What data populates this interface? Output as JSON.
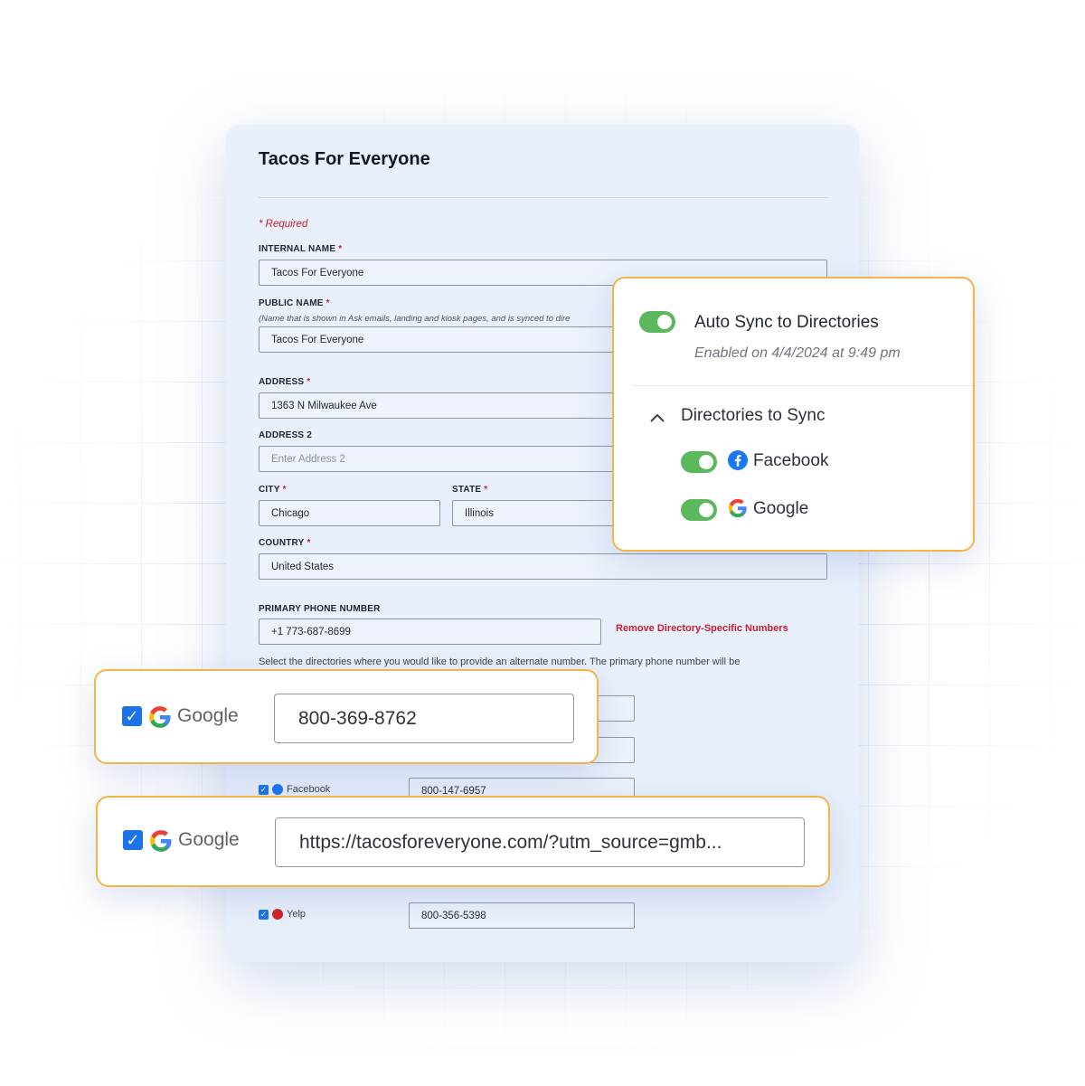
{
  "form": {
    "title": "Tacos For Everyone",
    "required_note": "* Required",
    "internal_name": {
      "label": "INTERNAL NAME",
      "value": "Tacos For Everyone"
    },
    "public_name": {
      "label": "PUBLIC NAME",
      "helper": "(Name that is shown in Ask emails, landing and kiosk pages, and is synced to dire",
      "value": "Tacos For Everyone"
    },
    "address": {
      "label": "ADDRESS",
      "value": "1363 N Milwaukee Ave"
    },
    "address2": {
      "label": "ADDRESS 2",
      "placeholder": "Enter Address 2"
    },
    "city": {
      "label": "CITY",
      "value": "Chicago"
    },
    "state": {
      "label": "STATE",
      "value": "Illinois"
    },
    "country": {
      "label": "COUNTRY",
      "value": "United States"
    },
    "primary_phone": {
      "label": "PRIMARY PHONE NUMBER",
      "value": "+1 773-687-8699"
    },
    "remove_link": "Remove Directory-Specific Numbers",
    "select_text": "Select the directories where you would like to provide an alternate number. The primary phone number will be",
    "directories": [
      {
        "name": "Facebook",
        "number": "800-147-6957"
      },
      {
        "name": "Yelp",
        "number": "800-356-5398"
      }
    ]
  },
  "sync_card": {
    "auto_sync_label": "Auto Sync to Directories",
    "enabled_text": "Enabled on 4/4/2024 at 9:49 pm",
    "directories_title": "Directories to Sync",
    "directories": [
      {
        "name": "Facebook",
        "enabled": true
      },
      {
        "name": "Google",
        "enabled": true
      }
    ]
  },
  "google_phone_card": {
    "label": "Google",
    "value": "800-369-8762"
  },
  "google_url_card": {
    "label": "Google",
    "value": "https://tacosforeveryone.com/?utm_source=gmb..."
  },
  "colors": {
    "accent": "#f3b54a",
    "toggle_on": "#5cb85c",
    "required": "#c8202f",
    "checkbox": "#1a73e8",
    "card_bg": "#e9f0fc"
  }
}
